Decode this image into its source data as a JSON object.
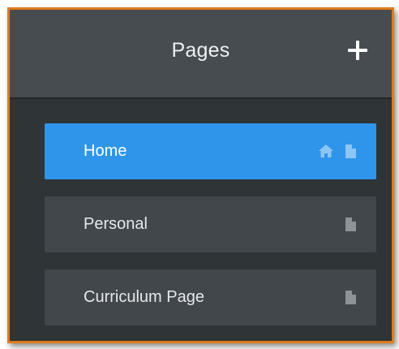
{
  "panel": {
    "title": "Pages",
    "add_icon": "plus-icon"
  },
  "pages": [
    {
      "label": "Home",
      "active": true,
      "icons": [
        "home-icon",
        "page-icon"
      ]
    },
    {
      "label": "Personal",
      "active": false,
      "icons": [
        "page-icon"
      ]
    },
    {
      "label": "Curriculum Page",
      "active": false,
      "icons": [
        "page-icon"
      ]
    }
  ],
  "colors": {
    "frame_border": "#e07a1c",
    "header_bg": "#474c50",
    "panel_bg": "#2f3437",
    "item_bg": "#42474b",
    "active_bg": "#2f95ea",
    "icon_on_active": "#8cc6f4",
    "icon_default": "#8e9397"
  }
}
